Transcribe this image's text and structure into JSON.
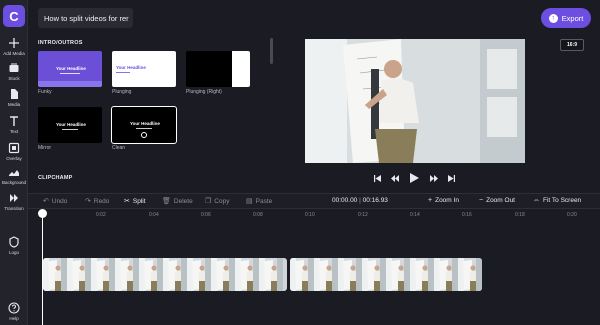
{
  "app": {
    "logo": "C",
    "project_title": "How to split videos for rer",
    "export_label": "Export",
    "aspect_ratio": "16:9",
    "accent": "#6c4fe0"
  },
  "sidebar": {
    "items": [
      {
        "label": "Add Media",
        "icon": "plus-icon"
      },
      {
        "label": "Stock",
        "icon": "stock-icon"
      },
      {
        "label": "Media",
        "icon": "media-icon"
      },
      {
        "label": "Text",
        "icon": "text-icon"
      },
      {
        "label": "Overlay",
        "icon": "overlay-icon"
      },
      {
        "label": "Background",
        "icon": "background-icon"
      },
      {
        "label": "Transition",
        "icon": "transition-icon"
      },
      {
        "label": "Logo",
        "icon": "logo-icon"
      },
      {
        "label": "Help",
        "icon": "help-icon"
      }
    ]
  },
  "media": {
    "section1": "INTRO/OUTROS",
    "section2": "CLIPCHAMP",
    "headline": "Your Headline",
    "thumbs": [
      {
        "caption": "Funky"
      },
      {
        "caption": "Plunging"
      },
      {
        "caption": "Plunging (Right)"
      },
      {
        "caption": "Mirror"
      },
      {
        "caption": "Clean"
      }
    ]
  },
  "toolbar": {
    "undo": "Undo",
    "redo": "Redo",
    "split": "Split",
    "delete": "Delete",
    "copy": "Copy",
    "paste": "Paste",
    "time_current": "00:00.00",
    "time_sep": " | ",
    "time_total": "00:16.93",
    "zoom_in": "Zoom In",
    "zoom_out": "Zoom Out",
    "fit": "Fit To Screen"
  },
  "ruler": [
    "0:02",
    "0:04",
    "0:06",
    "0:08",
    "0:10",
    "0:12",
    "0:14",
    "0:16",
    "0:18",
    "0:20"
  ]
}
